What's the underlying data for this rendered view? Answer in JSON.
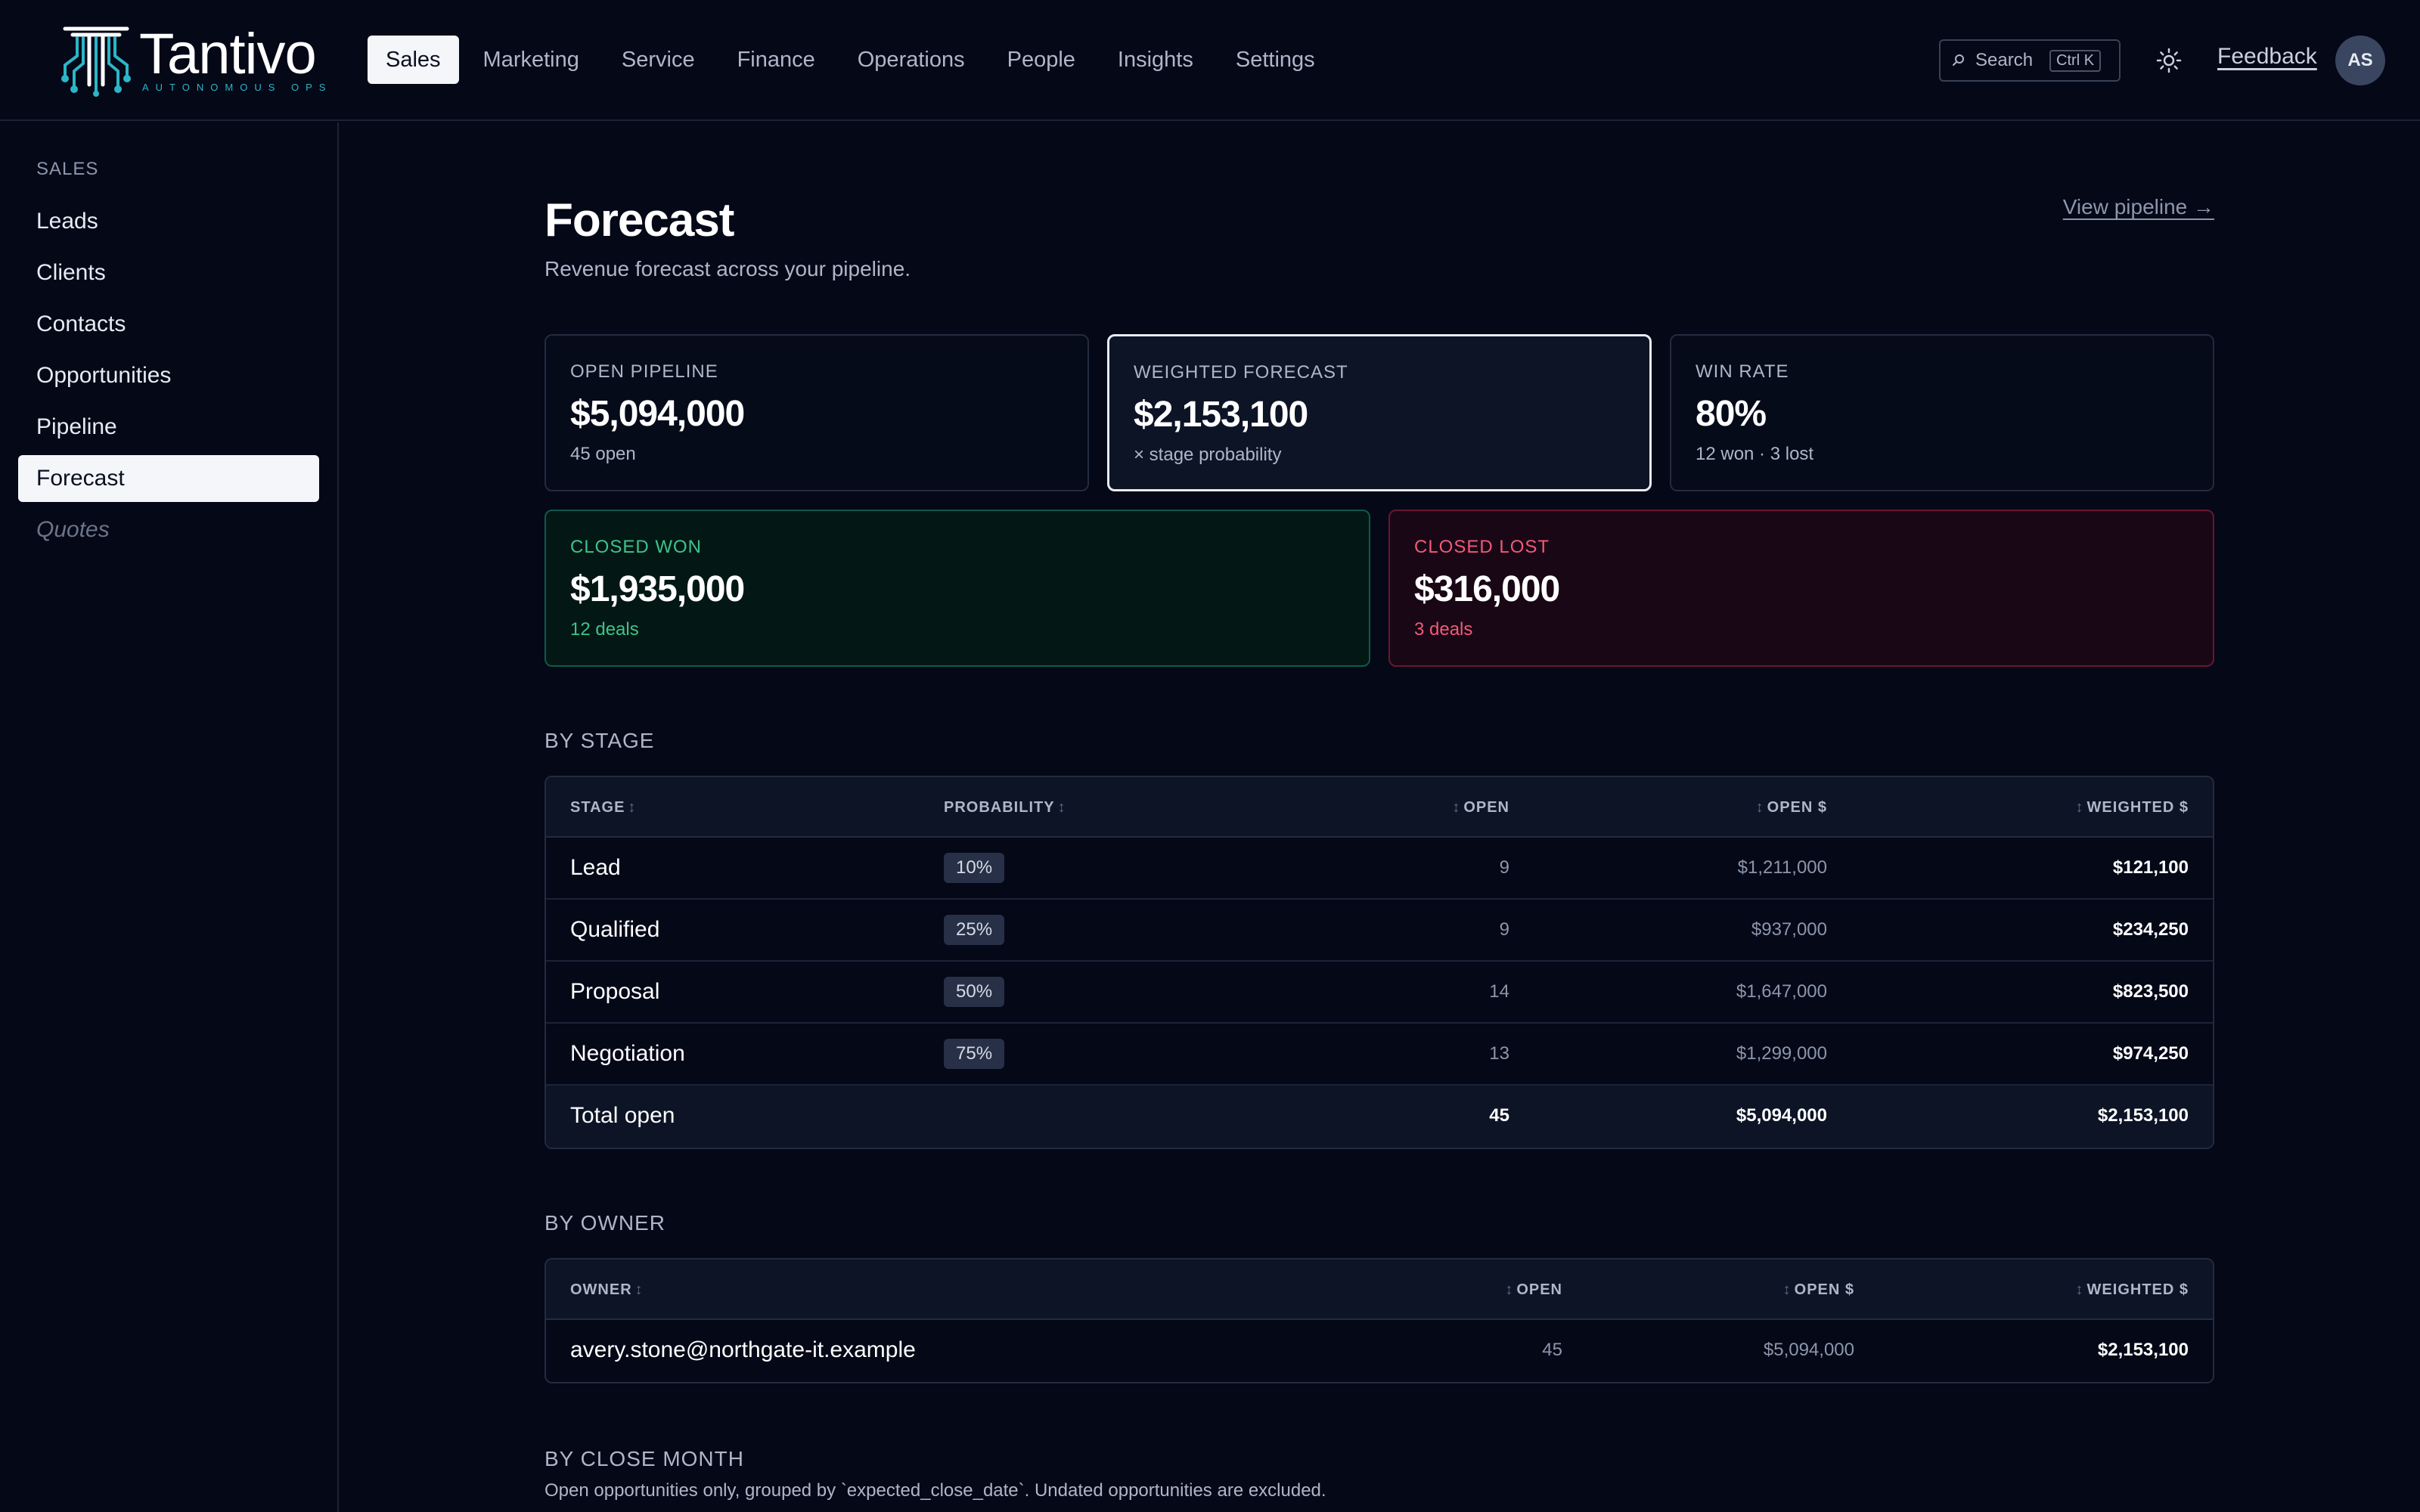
{
  "brand": {
    "name": "Tantivo",
    "tagline": "AUTONOMOUS OPS"
  },
  "nav": {
    "items": [
      "Sales",
      "Marketing",
      "Service",
      "Finance",
      "Operations",
      "People",
      "Insights",
      "Settings"
    ],
    "active": "Sales"
  },
  "header": {
    "search_label": "Search",
    "search_shortcut": "Ctrl K",
    "feedback": "Feedback",
    "avatar_initials": "AS"
  },
  "sidebar": {
    "heading": "SALES",
    "items": [
      {
        "label": "Leads"
      },
      {
        "label": "Clients"
      },
      {
        "label": "Contacts"
      },
      {
        "label": "Opportunities"
      },
      {
        "label": "Pipeline"
      },
      {
        "label": "Forecast"
      },
      {
        "label": "Quotes"
      }
    ],
    "active": "Forecast"
  },
  "page": {
    "title": "Forecast",
    "subtitle": "Revenue forecast across your pipeline.",
    "view_link": "View pipeline →"
  },
  "cards": {
    "open_pipeline": {
      "label": "OPEN PIPELINE",
      "value": "$5,094,000",
      "note": "45 open"
    },
    "weighted": {
      "label": "WEIGHTED FORECAST",
      "value": "$2,153,100",
      "note": "× stage probability"
    },
    "win_rate": {
      "label": "WIN RATE",
      "value": "80%",
      "note": "12 won · 3 lost"
    },
    "closed_won": {
      "label": "CLOSED WON",
      "value": "$1,935,000",
      "note": "12 deals"
    },
    "closed_lost": {
      "label": "CLOSED LOST",
      "value": "$316,000",
      "note": "3 deals"
    }
  },
  "by_stage": {
    "title": "BY STAGE",
    "headers": {
      "stage": "STAGE",
      "probability": "PROBABILITY",
      "open": "OPEN",
      "open_amount": "OPEN $",
      "weighted": "WEIGHTED $"
    },
    "rows": [
      {
        "stage": "Lead",
        "probability": "10%",
        "open": "9",
        "open_amount": "$1,211,000",
        "weighted": "$121,100"
      },
      {
        "stage": "Qualified",
        "probability": "25%",
        "open": "9",
        "open_amount": "$937,000",
        "weighted": "$234,250"
      },
      {
        "stage": "Proposal",
        "probability": "50%",
        "open": "14",
        "open_amount": "$1,647,000",
        "weighted": "$823,500"
      },
      {
        "stage": "Negotiation",
        "probability": "75%",
        "open": "13",
        "open_amount": "$1,299,000",
        "weighted": "$974,250"
      }
    ],
    "total": {
      "stage": "Total open",
      "open": "45",
      "open_amount": "$5,094,000",
      "weighted": "$2,153,100"
    }
  },
  "by_owner": {
    "title": "BY OWNER",
    "headers": {
      "owner": "OWNER",
      "open": "OPEN",
      "open_amount": "OPEN $",
      "weighted": "WEIGHTED $"
    },
    "rows": [
      {
        "owner": "avery.stone@northgate-it.example",
        "open": "45",
        "open_amount": "$5,094,000",
        "weighted": "$2,153,100"
      }
    ]
  },
  "by_close_month": {
    "title": "BY CLOSE MONTH",
    "description": "Open opportunities only, grouped by `expected_close_date`. Undated opportunities are excluded."
  }
}
